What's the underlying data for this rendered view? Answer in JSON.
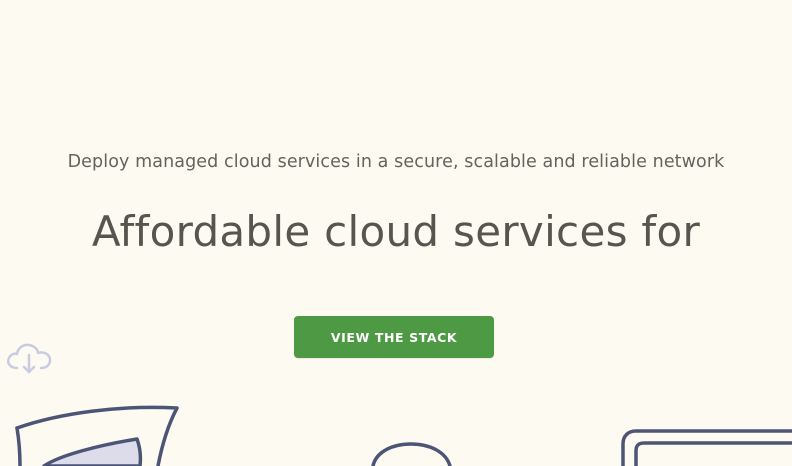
{
  "hero": {
    "subtitle": "Deploy managed cloud services in a secure, scalable and reliable network",
    "headline": "Affordable cloud services for",
    "cta_label": "VIEW THE STACK"
  },
  "icons": {
    "cloud_download": "cloud-download-icon",
    "document": "document-sketch",
    "circle": "circle-sketch",
    "monitor": "monitor-sketch"
  },
  "colors": {
    "background": "#fdfaf2",
    "headline_text": "#58544f",
    "subtitle_text": "#66625c",
    "cta_background": "#4e9944",
    "cta_text": "#ffffff",
    "sketch_stroke": "#4d5577",
    "cloud_icon_stroke": "#c9cbe0"
  }
}
